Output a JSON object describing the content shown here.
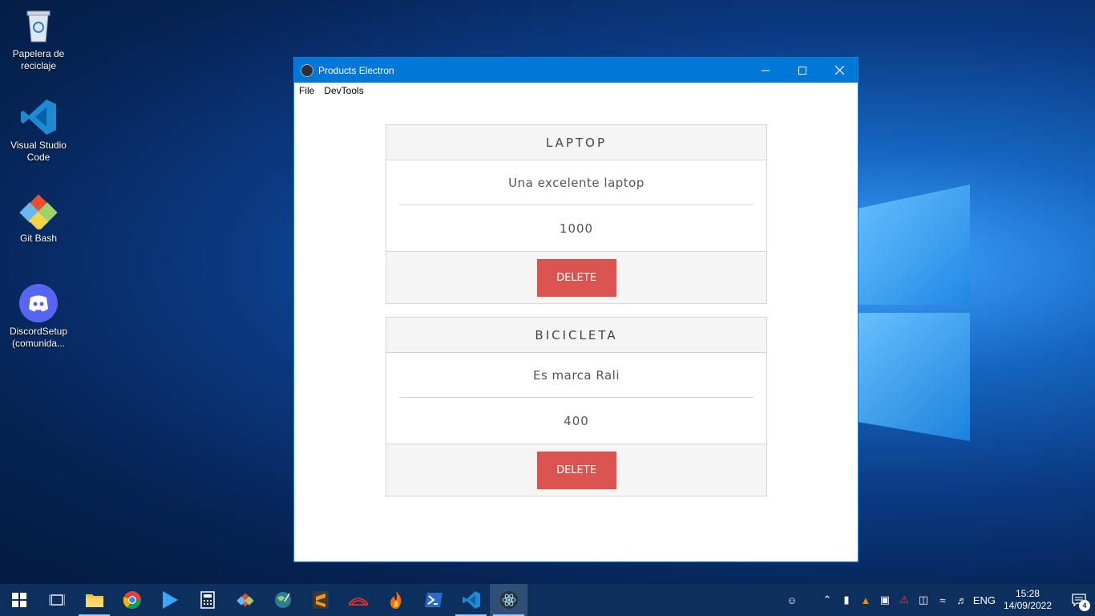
{
  "desktop": {
    "icons": [
      {
        "label": "Papelera de reciclaje",
        "icon": "recycle-bin-icon"
      },
      {
        "label": "Visual Studio Code",
        "icon": "vscode-icon"
      },
      {
        "label": "Git Bash",
        "icon": "git-bash-icon"
      },
      {
        "label": "DiscordSetup (comunida...",
        "icon": "discord-icon"
      }
    ]
  },
  "window": {
    "title": "Products Electron",
    "menu": [
      "File",
      "DevTools"
    ]
  },
  "products": [
    {
      "name": "LAPTOP",
      "description": "Una excelente laptop",
      "price": "1000",
      "delete_label": "DELETE"
    },
    {
      "name": "BICICLETA",
      "description": "Es marca Rali",
      "price": "400",
      "delete_label": "DELETE"
    }
  ],
  "taskbar": {
    "apps": [
      "start",
      "task-view",
      "file-explorer",
      "chrome",
      "play",
      "calculator",
      "git-gui",
      "earth",
      "sublime",
      "red-app",
      "fire",
      "powershell",
      "vscode",
      "electron"
    ],
    "tray": {
      "language": "ENG",
      "time": "15:28",
      "date": "14/09/2022",
      "notification_count": "4"
    }
  },
  "colors": {
    "titlebar": "#0078d7",
    "delete_button": "#d9534f",
    "taskbar": "#0d2f5e"
  }
}
